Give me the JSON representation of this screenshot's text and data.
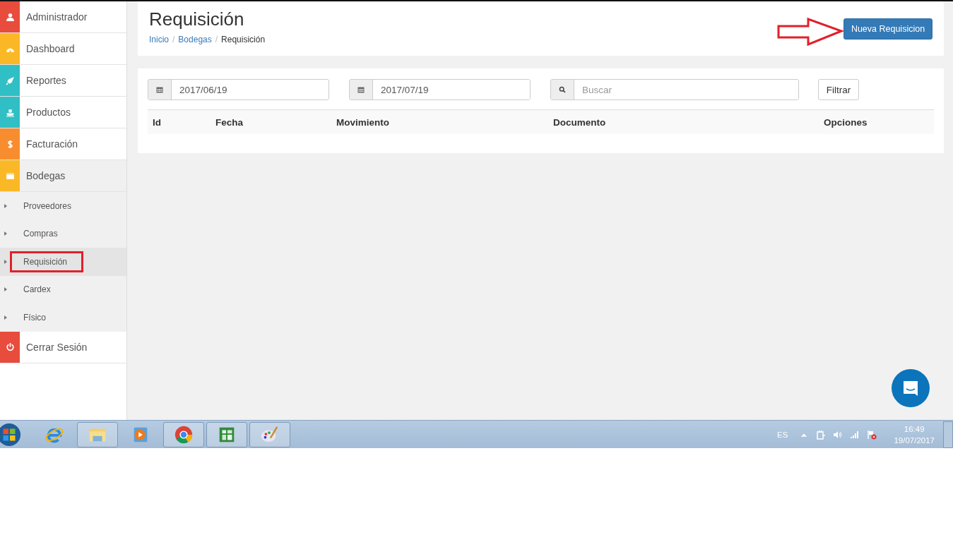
{
  "sidebar": {
    "items": [
      {
        "label": "Administrador",
        "kind": "main",
        "color": "#e84c3d",
        "selected": false
      },
      {
        "label": "Dashboard",
        "kind": "main",
        "color": "#fbb826",
        "selected": false
      },
      {
        "label": "Reportes",
        "kind": "main",
        "color": "#2fbfc5",
        "selected": false
      },
      {
        "label": "Productos",
        "kind": "main",
        "color": "#2fbfc5",
        "selected": false
      },
      {
        "label": "Facturación",
        "kind": "main",
        "color": "#f88d2f",
        "selected": false
      },
      {
        "label": "Bodegas",
        "kind": "main",
        "color": "#fbb826",
        "selected": true
      },
      {
        "label": "Proveedores",
        "kind": "sub",
        "selected": false
      },
      {
        "label": "Compras",
        "kind": "sub",
        "selected": false
      },
      {
        "label": "Requisición",
        "kind": "sub",
        "selected": true
      },
      {
        "label": "Cardex",
        "kind": "sub",
        "selected": false
      },
      {
        "label": "Físico",
        "kind": "sub",
        "selected": false
      },
      {
        "label": "Cerrar Sesión",
        "kind": "main",
        "color": "#e84c3d",
        "selected": false
      }
    ]
  },
  "header": {
    "title": "Requisición",
    "breadcrumb_separator": "/",
    "breadcrumb": [
      {
        "label": "Inicio",
        "kind": "link"
      },
      {
        "label": "Bodegas",
        "kind": "link"
      },
      {
        "label": "Requisición",
        "kind": "current"
      }
    ],
    "button": "Nueva Requisicion"
  },
  "filters": {
    "date_from": "2017/06/19",
    "date_to": "2017/07/19",
    "search": {
      "placeholder": "Buscar"
    },
    "button": "Filtrar"
  },
  "table": {
    "columns": [
      "Id",
      "Fecha",
      "Movimiento",
      "Documento",
      "Opciones"
    ]
  },
  "taskbar": {
    "language": "ES",
    "time": "16:49",
    "date": "19/07/2017"
  }
}
